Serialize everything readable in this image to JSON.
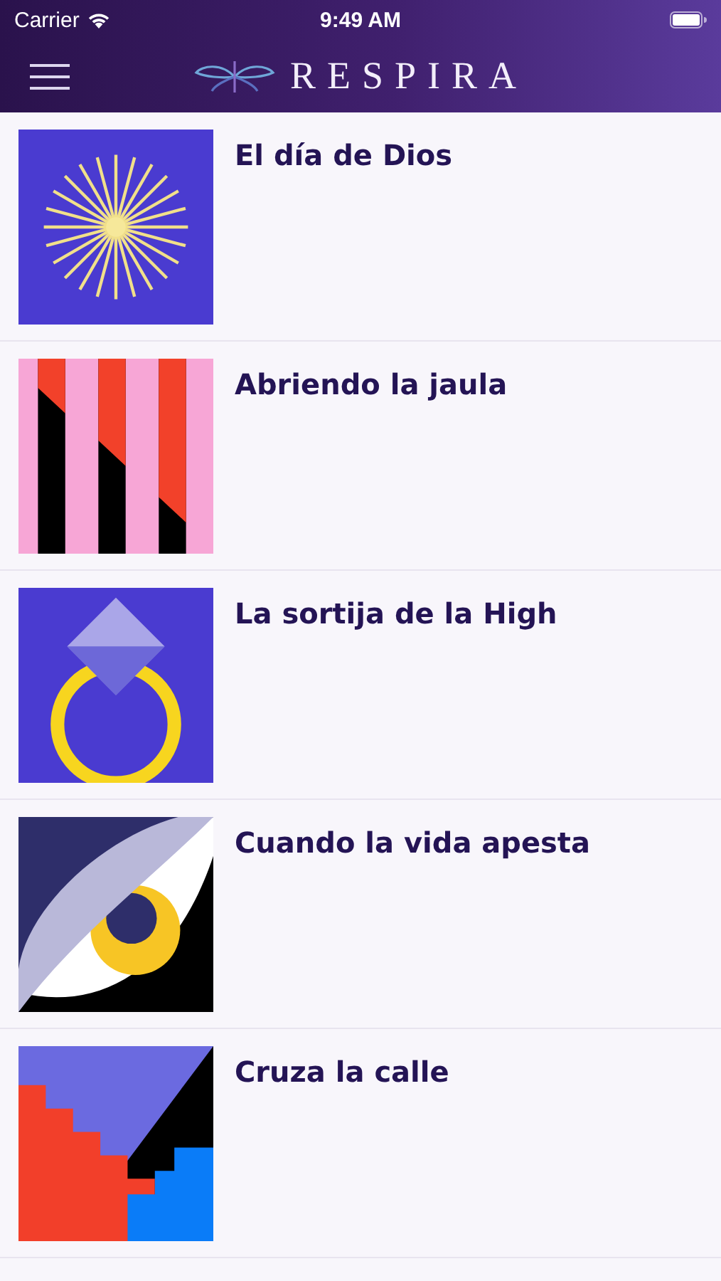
{
  "status_bar": {
    "carrier": "Carrier",
    "time": "9:49 AM"
  },
  "nav_bar": {
    "logo_text": "RESPIRA"
  },
  "episodes": [
    {
      "title": "El día de Dios",
      "kind": "sunburst"
    },
    {
      "title": "Abriendo la jaula",
      "kind": "stripes"
    },
    {
      "title": "La sortija de la High",
      "kind": "ring"
    },
    {
      "title": "Cuando la vida apesta",
      "kind": "eye"
    },
    {
      "title": "Cruza la calle",
      "kind": "stairs"
    }
  ]
}
